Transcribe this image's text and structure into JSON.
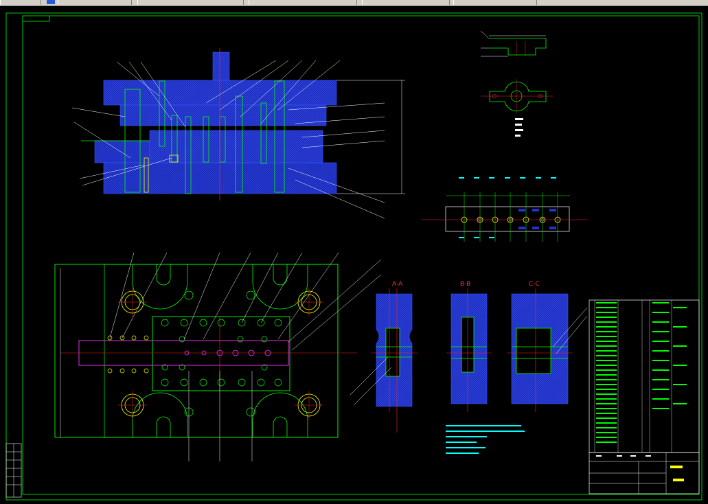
{
  "toolbar": {
    "cells": 6
  },
  "sections": {
    "a": "A-A",
    "b": "B-B",
    "c": "C-C"
  },
  "colors": {
    "background": "#000000",
    "border": "#00ff00",
    "fill_blue": "#2233cc",
    "centerline": "#ff2222",
    "leader": "#00ffff",
    "magenta": "#ff33ff",
    "yellow": "#ffff00",
    "white": "#ffffff"
  }
}
